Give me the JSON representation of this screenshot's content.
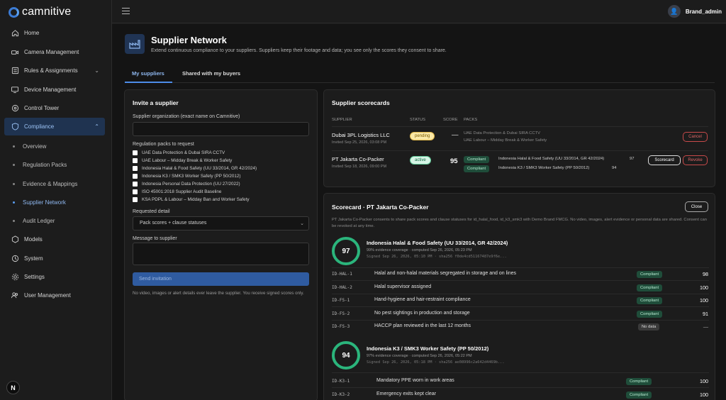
{
  "brand": {
    "name": "camnitive"
  },
  "user": {
    "name": "Brand_admin"
  },
  "nav": {
    "items": [
      {
        "label": "Home",
        "icon": "home-icon"
      },
      {
        "label": "Camera Management",
        "icon": "camera-icon"
      },
      {
        "label": "Rules & Assignments",
        "icon": "rules-icon"
      },
      {
        "label": "Device Management",
        "icon": "device-icon"
      },
      {
        "label": "Control Tower",
        "icon": "control-tower-icon"
      },
      {
        "label": "Compliance",
        "icon": "shield-icon"
      }
    ],
    "sub_items": [
      "Overview",
      "Regulation Packs",
      "Evidence & Mappings",
      "Supplier Network",
      "Audit Ledger"
    ],
    "items_after": [
      {
        "label": "Models",
        "icon": "models-icon"
      },
      {
        "label": "System",
        "icon": "system-icon"
      },
      {
        "label": "Settings",
        "icon": "gear-icon"
      },
      {
        "label": "User Management",
        "icon": "users-icon"
      }
    ],
    "badge": "N"
  },
  "header": {
    "title": "Supplier Network",
    "subtitle": "Extend continuous compliance to your suppliers. Suppliers keep their footage and data; you see only the scores they consent to share."
  },
  "tabs": [
    "My suppliers",
    "Shared with my buyers"
  ],
  "invite": {
    "title": "Invite a supplier",
    "org_label": "Supplier organization (exact name on Camnitive)",
    "org_value": "",
    "packs_label": "Regulation packs to request",
    "packs": [
      "UAE Data Protection & Dubai SIRA CCTV",
      "UAE Labour – Midday Break & Worker Safety",
      "Indonesia Halal & Food Safety (UU 33/2014, GR 42/2024)",
      "Indonesia K3 / SMK3 Worker Safety (PP 50/2012)",
      "Indonesia Personal Data Protection (UU 27/2022)",
      "ISO 45001:2018 Supplier Audit Baseline",
      "KSA PDPL & Labour – Midday Ban and Worker Safety"
    ],
    "detail_label": "Requested detail",
    "detail_value": "Pack scores + clause statuses",
    "message_label": "Message to supplier",
    "message_value": "",
    "send_label": "Send invitation",
    "note": "No video, images or alert details ever leave the supplier. You receive signed scores only."
  },
  "scorecards": {
    "title": "Supplier scorecards",
    "columns": [
      "SUPPLIER",
      "STATUS",
      "SCORE",
      "PACKS"
    ],
    "rows": [
      {
        "name": "Dubai 3PL Logistics LLC",
        "sub": "Invited Sep 25, 2026, 03:08 PM",
        "status": "pending",
        "score": "—",
        "packs": [
          "UAE Data Protection & Dubai SIRA CCTV",
          "UAE Labour – Midday Break & Worker Safety"
        ],
        "action": "Cancel"
      },
      {
        "name": "PT Jakarta Co-Packer",
        "sub": "Invited Sep 18, 2026, 09:00 PM",
        "status": "active",
        "score": "95",
        "packs": [
          {
            "tag": "Compliant",
            "name": "Indonesia Halal & Food Safety (UU 33/2014, GR 42/2024)",
            "score": "97"
          },
          {
            "tag": "Compliant",
            "name": "Indonesia K3 / SMK3 Worker Safety (PP 50/2012)",
            "score": "94"
          }
        ],
        "action1": "Scorecard",
        "action2": "Revoke"
      }
    ]
  },
  "detail": {
    "title": "Scorecard · PT Jakarta Co-Packer",
    "close": "Close",
    "consent": "PT Jakarta Co-Packer consents to share pack scores and clause statuses for id_halal_food, id_k3_smk3 with Demo Brand FMCG. No video, images, alert evidence or personal data are shared. Consent can be revoked at any time.",
    "packs": [
      {
        "score": "97",
        "name": "Indonesia Halal & Food Safety (UU 33/2014, GR 42/2024)",
        "coverage": "99% evidence coverage · computed Sep 26, 2026, 05:23 PM",
        "signed": "Signed Sep 26, 2026, 05:10 PM · sha256 f0de4cd51167487e9f6e...",
        "clauses": [
          {
            "code": "ID-HAL-1",
            "text": "Halal and non-halal materials segregated in storage and on lines",
            "status": "Compliant",
            "score": "98"
          },
          {
            "code": "ID-HAL-2",
            "text": "Halal supervisor assigned",
            "status": "Compliant",
            "score": "100"
          },
          {
            "code": "ID-FS-1",
            "text": "Hand-hygiene and hair-restraint compliance",
            "status": "Compliant",
            "score": "100"
          },
          {
            "code": "ID-FS-2",
            "text": "No pest sightings in production and storage",
            "status": "Compliant",
            "score": "91"
          },
          {
            "code": "ID-FS-3",
            "text": "HACCP plan reviewed in the last 12 months",
            "status": "No data",
            "score": "—"
          }
        ]
      },
      {
        "score": "94",
        "name": "Indonesia K3 / SMK3 Worker Safety (PP 50/2012)",
        "coverage": "97% evidence coverage · computed Sep 26, 2026, 05:22 PM",
        "signed": "Signed Sep 26, 2026, 05:18 PM · sha256 ae08996c2a642d4469b...",
        "clauses": [
          {
            "code": "ID-K3-1",
            "text": "Mandatory PPE worn in work areas",
            "status": "Compliant",
            "score": "100"
          },
          {
            "code": "ID-K3-2",
            "text": "Emergency exits kept clear",
            "status": "Compliant",
            "score": "100"
          }
        ]
      }
    ]
  },
  "colors": {
    "accent": "#4d8ce8",
    "compliant": "#2bb57c",
    "danger": "#c84a4a"
  }
}
